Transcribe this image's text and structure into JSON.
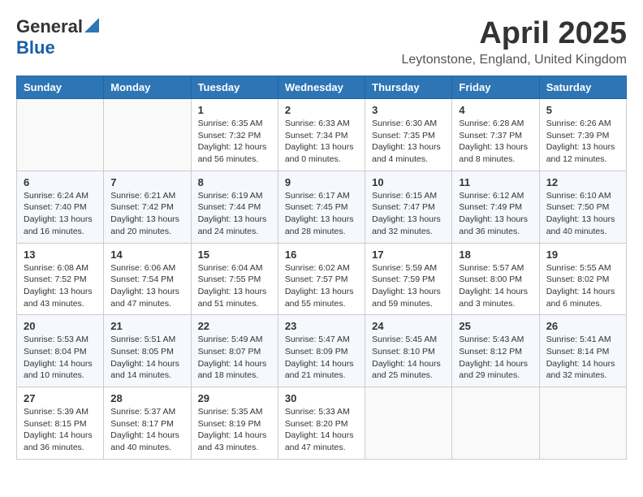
{
  "header": {
    "logo_general": "General",
    "logo_blue": "Blue",
    "month_title": "April 2025",
    "location": "Leytonstone, England, United Kingdom"
  },
  "weekdays": [
    "Sunday",
    "Monday",
    "Tuesday",
    "Wednesday",
    "Thursday",
    "Friday",
    "Saturday"
  ],
  "weeks": [
    [
      {
        "day": "",
        "info": ""
      },
      {
        "day": "",
        "info": ""
      },
      {
        "day": "1",
        "info": "Sunrise: 6:35 AM\nSunset: 7:32 PM\nDaylight: 12 hours and 56 minutes."
      },
      {
        "day": "2",
        "info": "Sunrise: 6:33 AM\nSunset: 7:34 PM\nDaylight: 13 hours and 0 minutes."
      },
      {
        "day": "3",
        "info": "Sunrise: 6:30 AM\nSunset: 7:35 PM\nDaylight: 13 hours and 4 minutes."
      },
      {
        "day": "4",
        "info": "Sunrise: 6:28 AM\nSunset: 7:37 PM\nDaylight: 13 hours and 8 minutes."
      },
      {
        "day": "5",
        "info": "Sunrise: 6:26 AM\nSunset: 7:39 PM\nDaylight: 13 hours and 12 minutes."
      }
    ],
    [
      {
        "day": "6",
        "info": "Sunrise: 6:24 AM\nSunset: 7:40 PM\nDaylight: 13 hours and 16 minutes."
      },
      {
        "day": "7",
        "info": "Sunrise: 6:21 AM\nSunset: 7:42 PM\nDaylight: 13 hours and 20 minutes."
      },
      {
        "day": "8",
        "info": "Sunrise: 6:19 AM\nSunset: 7:44 PM\nDaylight: 13 hours and 24 minutes."
      },
      {
        "day": "9",
        "info": "Sunrise: 6:17 AM\nSunset: 7:45 PM\nDaylight: 13 hours and 28 minutes."
      },
      {
        "day": "10",
        "info": "Sunrise: 6:15 AM\nSunset: 7:47 PM\nDaylight: 13 hours and 32 minutes."
      },
      {
        "day": "11",
        "info": "Sunrise: 6:12 AM\nSunset: 7:49 PM\nDaylight: 13 hours and 36 minutes."
      },
      {
        "day": "12",
        "info": "Sunrise: 6:10 AM\nSunset: 7:50 PM\nDaylight: 13 hours and 40 minutes."
      }
    ],
    [
      {
        "day": "13",
        "info": "Sunrise: 6:08 AM\nSunset: 7:52 PM\nDaylight: 13 hours and 43 minutes."
      },
      {
        "day": "14",
        "info": "Sunrise: 6:06 AM\nSunset: 7:54 PM\nDaylight: 13 hours and 47 minutes."
      },
      {
        "day": "15",
        "info": "Sunrise: 6:04 AM\nSunset: 7:55 PM\nDaylight: 13 hours and 51 minutes."
      },
      {
        "day": "16",
        "info": "Sunrise: 6:02 AM\nSunset: 7:57 PM\nDaylight: 13 hours and 55 minutes."
      },
      {
        "day": "17",
        "info": "Sunrise: 5:59 AM\nSunset: 7:59 PM\nDaylight: 13 hours and 59 minutes."
      },
      {
        "day": "18",
        "info": "Sunrise: 5:57 AM\nSunset: 8:00 PM\nDaylight: 14 hours and 3 minutes."
      },
      {
        "day": "19",
        "info": "Sunrise: 5:55 AM\nSunset: 8:02 PM\nDaylight: 14 hours and 6 minutes."
      }
    ],
    [
      {
        "day": "20",
        "info": "Sunrise: 5:53 AM\nSunset: 8:04 PM\nDaylight: 14 hours and 10 minutes."
      },
      {
        "day": "21",
        "info": "Sunrise: 5:51 AM\nSunset: 8:05 PM\nDaylight: 14 hours and 14 minutes."
      },
      {
        "day": "22",
        "info": "Sunrise: 5:49 AM\nSunset: 8:07 PM\nDaylight: 14 hours and 18 minutes."
      },
      {
        "day": "23",
        "info": "Sunrise: 5:47 AM\nSunset: 8:09 PM\nDaylight: 14 hours and 21 minutes."
      },
      {
        "day": "24",
        "info": "Sunrise: 5:45 AM\nSunset: 8:10 PM\nDaylight: 14 hours and 25 minutes."
      },
      {
        "day": "25",
        "info": "Sunrise: 5:43 AM\nSunset: 8:12 PM\nDaylight: 14 hours and 29 minutes."
      },
      {
        "day": "26",
        "info": "Sunrise: 5:41 AM\nSunset: 8:14 PM\nDaylight: 14 hours and 32 minutes."
      }
    ],
    [
      {
        "day": "27",
        "info": "Sunrise: 5:39 AM\nSunset: 8:15 PM\nDaylight: 14 hours and 36 minutes."
      },
      {
        "day": "28",
        "info": "Sunrise: 5:37 AM\nSunset: 8:17 PM\nDaylight: 14 hours and 40 minutes."
      },
      {
        "day": "29",
        "info": "Sunrise: 5:35 AM\nSunset: 8:19 PM\nDaylight: 14 hours and 43 minutes."
      },
      {
        "day": "30",
        "info": "Sunrise: 5:33 AM\nSunset: 8:20 PM\nDaylight: 14 hours and 47 minutes."
      },
      {
        "day": "",
        "info": ""
      },
      {
        "day": "",
        "info": ""
      },
      {
        "day": "",
        "info": ""
      }
    ]
  ]
}
